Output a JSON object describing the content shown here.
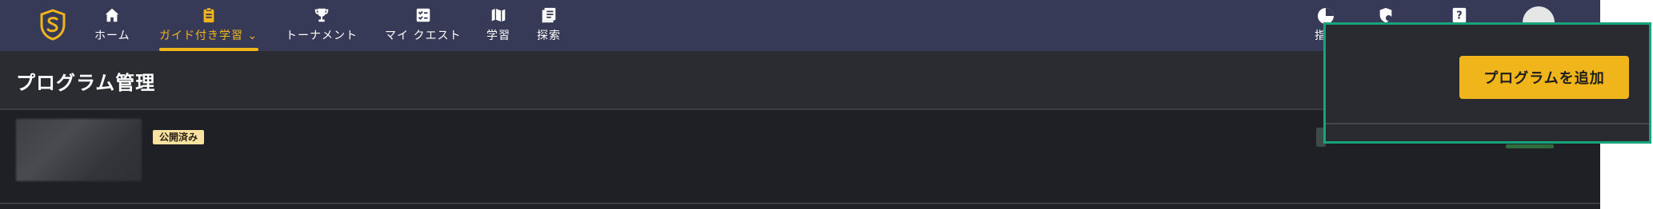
{
  "nav": {
    "items": [
      {
        "label": "ホーム",
        "icon": "home-icon"
      },
      {
        "label": "ガイド付き学習",
        "icon": "clipboard-icon",
        "active": true
      },
      {
        "label": "トーナメント",
        "icon": "trophy-icon"
      },
      {
        "label": "マイ クエスト",
        "icon": "checklist-icon"
      },
      {
        "label": "学習",
        "icon": "map-icon"
      },
      {
        "label": "探索",
        "icon": "document-search-icon"
      }
    ],
    "right_partial_label": "指",
    "right_icons": [
      "pie-chart-icon",
      "shield-gear-icon",
      "help-icon",
      "user-avatar"
    ]
  },
  "page": {
    "title": "プログラム管理"
  },
  "row": {
    "status_badge": "公開済み"
  },
  "overlay": {
    "add_program_label": "プログラムを追加"
  },
  "colors": {
    "nav_bg": "#363a56",
    "accent": "#f1b51c",
    "overlay_border": "#17a37d",
    "badge_bg": "#fae3a0"
  }
}
